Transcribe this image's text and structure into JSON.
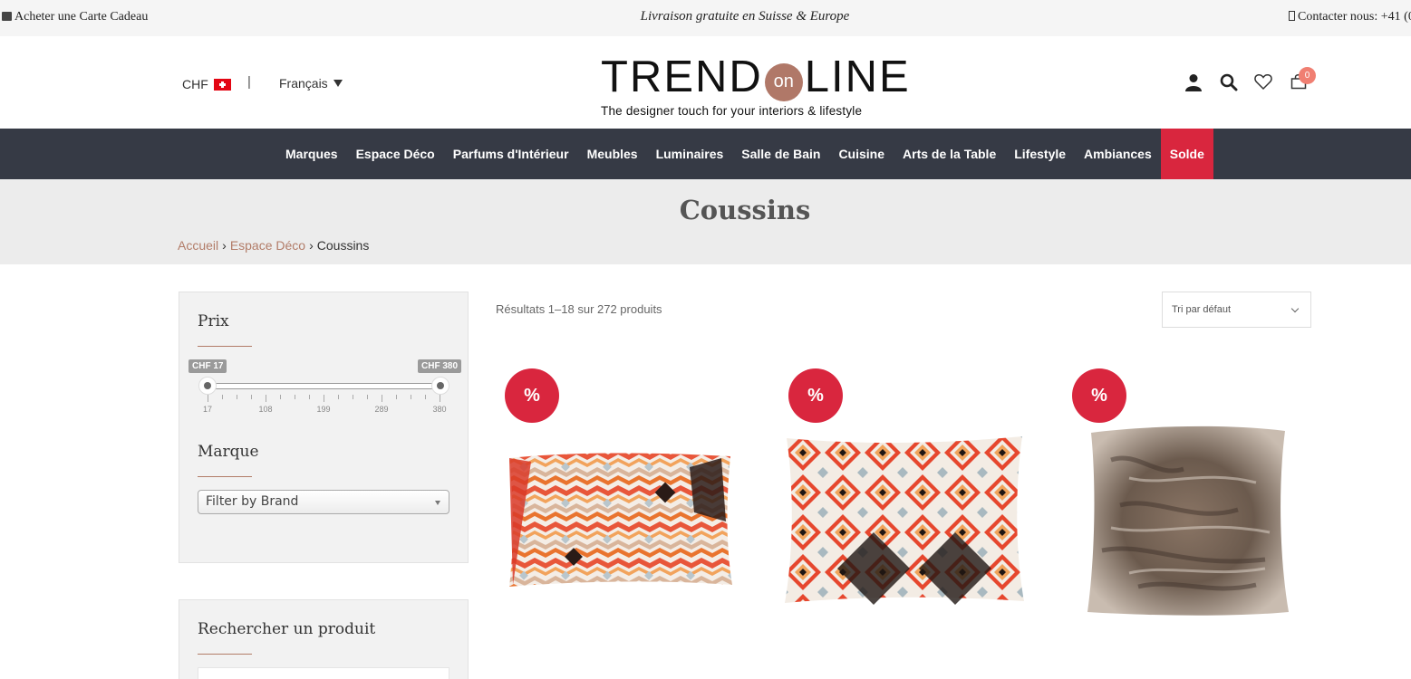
{
  "topbar": {
    "gift_label": "Acheter une Carte Cadeau",
    "shipping": "Livraison gratuite en Suisse & Europe",
    "contact": "Contacter nous: +41 (0"
  },
  "header": {
    "currency": "CHF",
    "separator": "|",
    "language": "Français",
    "logo_left": "TREND",
    "logo_on": "on",
    "logo_right": "LINE",
    "tagline": "The designer touch for your interiors & lifestyle",
    "cart_count": "0"
  },
  "nav": [
    "Marques",
    "Espace Déco",
    "Parfums d'Intérieur",
    "Meubles",
    "Luminaires",
    "Salle de Bain",
    "Cuisine",
    "Arts de la Table",
    "Lifestyle",
    "Ambiances",
    "Solde"
  ],
  "page": {
    "title": "Coussins",
    "breadcrumb": {
      "home": "Accueil",
      "parent": "Espace Déco",
      "current": "Coussins"
    }
  },
  "sidebar": {
    "price": {
      "title": "Prix",
      "min_label": "CHF 17",
      "max_label": "CHF 380",
      "ticks": [
        "17",
        "108",
        "199",
        "289",
        "380"
      ]
    },
    "brand": {
      "title": "Marque",
      "select_value": "Filter by Brand"
    },
    "search": {
      "title": "Rechercher un produit"
    }
  },
  "products": {
    "results_text": "Résultats 1–18 sur 272 produits",
    "sort_value": "Tri par défaut",
    "sale_badge": "%"
  },
  "colors": {
    "nav_bg": "#363a45",
    "sale": "#d9263e",
    "accent": "#b27c68"
  }
}
